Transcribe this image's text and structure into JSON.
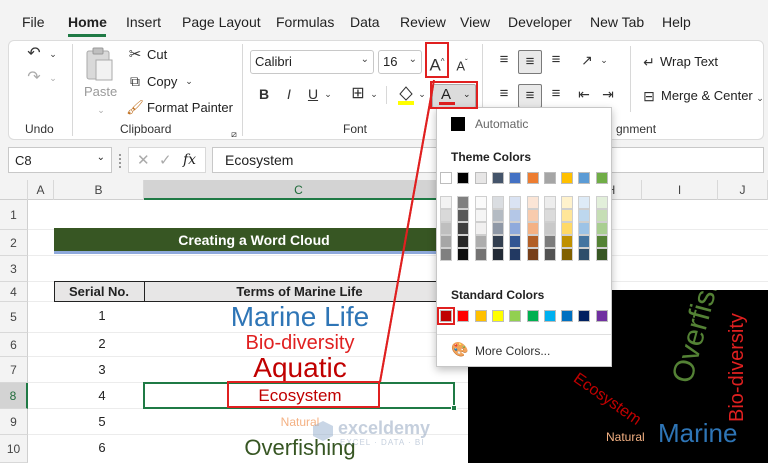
{
  "menubar": {
    "items": [
      "File",
      "Home",
      "Insert",
      "Page Layout",
      "Formulas",
      "Data",
      "Review",
      "View",
      "Developer",
      "New Tab",
      "Help"
    ],
    "active": "Home"
  },
  "ribbon": {
    "undo_group_label": "Undo",
    "clipboard": {
      "paste_label": "Paste",
      "cut_label": "Cut",
      "copy_label": "Copy",
      "format_painter_label": "Format Painter",
      "group_label": "Clipboard"
    },
    "font": {
      "font_name": "Calibri",
      "font_size": "16",
      "group_label": "Font",
      "bold": "B",
      "italic": "I",
      "underline": "U",
      "increase_font_glyph": "A",
      "decrease_font_glyph": "A",
      "font_color_glyph": "A",
      "font_color_bar": "#e02020"
    },
    "alignment": {
      "wrap_text_label": "Wrap Text",
      "merge_center_label": "Merge & Center",
      "group_label_partial": "gnment"
    }
  },
  "formula_bar": {
    "name_box": "C8",
    "fx": "fx",
    "value": "Ecosystem"
  },
  "grid": {
    "columns": [
      "A",
      "B",
      "C",
      "H",
      "I",
      "J"
    ],
    "rows": [
      "1",
      "2",
      "3",
      "4",
      "5",
      "6",
      "7",
      "8",
      "9",
      "10"
    ],
    "selected_column": "C",
    "selected_row": "8",
    "title_banner": "Creating a Word Cloud",
    "table_headers": [
      "Serial No.",
      "Terms of Marine Life"
    ],
    "table_rows": [
      {
        "serial": "1",
        "term": "Marine Life",
        "color": "#2e75b6"
      },
      {
        "serial": "2",
        "term": "Bio-diversity",
        "color": "#e02020"
      },
      {
        "serial": "3",
        "term": "Aquatic",
        "color": "#c00000"
      },
      {
        "serial": "4",
        "term": "Ecosystem",
        "color": "#c00000"
      },
      {
        "serial": "5",
        "term": "Natural",
        "color": "#f4b183"
      },
      {
        "serial": "6",
        "term": "Overfishing",
        "color": "#375623"
      }
    ]
  },
  "color_popup": {
    "automatic_label": "Automatic",
    "theme_colors_label": "Theme Colors",
    "standard_colors_label": "Standard Colors",
    "more_colors_label": "More Colors...",
    "theme_top": [
      "#ffffff",
      "#000000",
      "#e7e6e6",
      "#44546a",
      "#4472c4",
      "#ed7d31",
      "#a5a5a5",
      "#ffc000",
      "#5b9bd5",
      "#70ad47"
    ],
    "standard": [
      "#c00000",
      "#ff0000",
      "#ffc000",
      "#ffff00",
      "#92d050",
      "#00b050",
      "#00b0f0",
      "#0070c0",
      "#002060",
      "#7030a0"
    ]
  },
  "wordcloud": {
    "words": [
      "Overfishing",
      "Bio-diversity",
      "Ecosystem",
      "Natural",
      "Marine"
    ]
  },
  "watermark": {
    "brand": "exceldemy",
    "tagline": "EXCEL · DATA · BI"
  }
}
